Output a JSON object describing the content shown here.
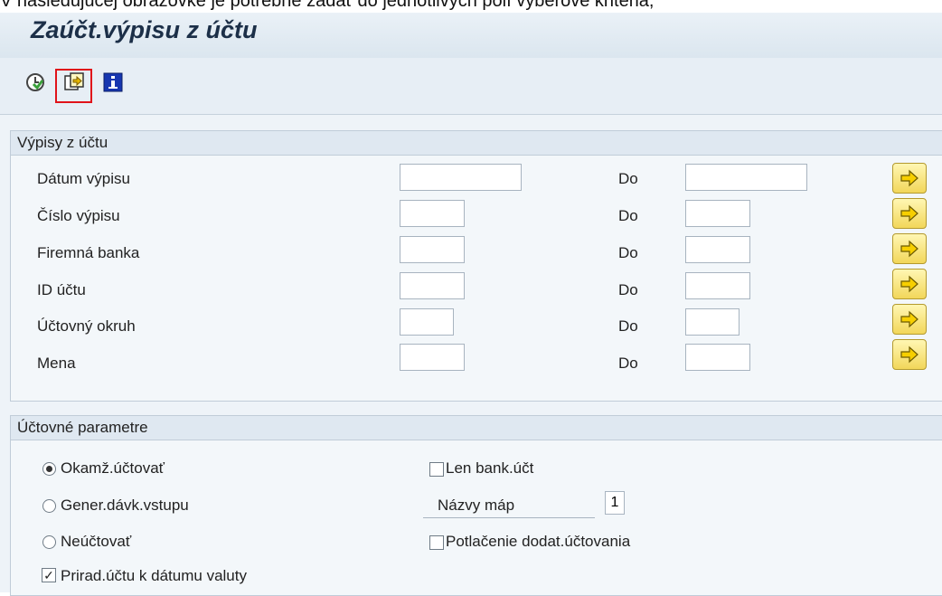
{
  "page": {
    "cropped_heading": "V nasledujúcej obrazovke je potrebné zadať do jednotlivých polí výberové kritéria,"
  },
  "app": {
    "title": "Zaúčt.výpisu z účtu"
  },
  "toolbar": {
    "buttons": [
      {
        "name": "execute-icon"
      },
      {
        "name": "get-variant-icon"
      },
      {
        "name": "info-icon"
      }
    ]
  },
  "statements_group": {
    "title": "Výpisy z účtu",
    "to_label": "Do",
    "rows": [
      {
        "label": "Dátum výpisu",
        "from_value": "",
        "to_value": ""
      },
      {
        "label": "Číslo výpisu",
        "from_value": "",
        "to_value": ""
      },
      {
        "label": "Firemná banka",
        "from_value": "",
        "to_value": ""
      },
      {
        "label": "ID účtu",
        "from_value": "",
        "to_value": ""
      },
      {
        "label": "Účtovný okruh",
        "from_value": "",
        "to_value": ""
      },
      {
        "label": "Mena",
        "from_value": "",
        "to_value": ""
      }
    ]
  },
  "posting_group": {
    "title": "Účtovné parametre",
    "radios": [
      {
        "label": "Okamž.účtovať",
        "selected": true
      },
      {
        "label": "Gener.dávk.vstupu",
        "selected": false
      },
      {
        "label": "Neúčtovať",
        "selected": false
      }
    ],
    "assign_checkbox": {
      "label": "Prirad.účtu k dátumu valuty",
      "checked": true
    },
    "bank_only_checkbox": {
      "label": "Len bank.účt",
      "checked": false
    },
    "map_names": {
      "label": "Názvy máp",
      "value": "1"
    },
    "suppress_checkbox": {
      "label": "Potlačenie dodat.účtovania",
      "checked": false
    }
  }
}
